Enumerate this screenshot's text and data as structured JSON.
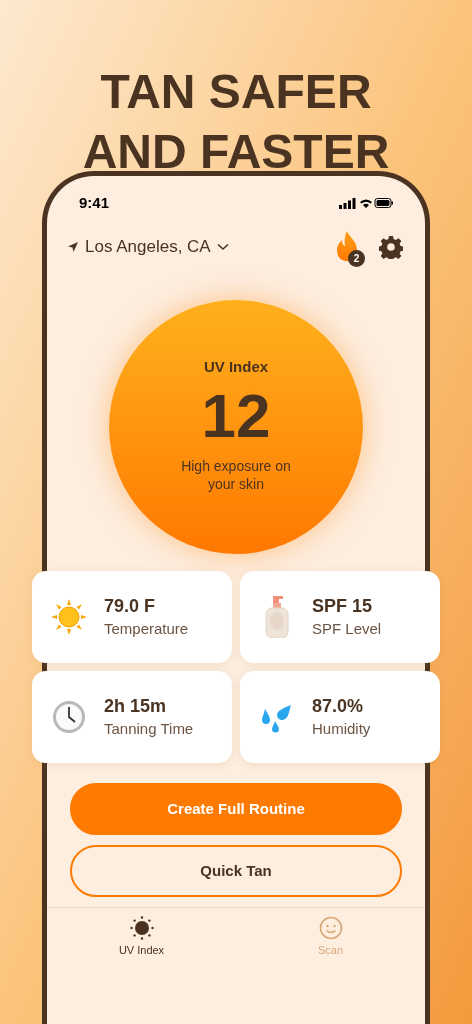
{
  "headline": [
    "TAN SAFER",
    "AND FASTER"
  ],
  "status_bar": {
    "time": "9:41"
  },
  "location": "Los Angeles, CA",
  "streak_badge": "2",
  "uv": {
    "label": "UV Index",
    "value": "12",
    "description": "High exposure on your skin"
  },
  "stats": [
    {
      "kind": "sun",
      "value": "79.0 F",
      "label": "Temperature"
    },
    {
      "kind": "bottle",
      "value": "SPF 15",
      "label": "SPF Level"
    },
    {
      "kind": "clock",
      "value": "2h 15m",
      "label": "Tanning Time"
    },
    {
      "kind": "drops",
      "value": "87.0%",
      "label": "Humidity"
    }
  ],
  "buttons": [
    {
      "kind": "primary",
      "label": "Create Full Routine"
    },
    {
      "kind": "outline",
      "label": "Quick Tan"
    }
  ],
  "tabs": [
    {
      "kind": "sun",
      "label": "UV Index",
      "selected": true
    },
    {
      "kind": "face",
      "label": "Scan",
      "selected": false
    }
  ]
}
